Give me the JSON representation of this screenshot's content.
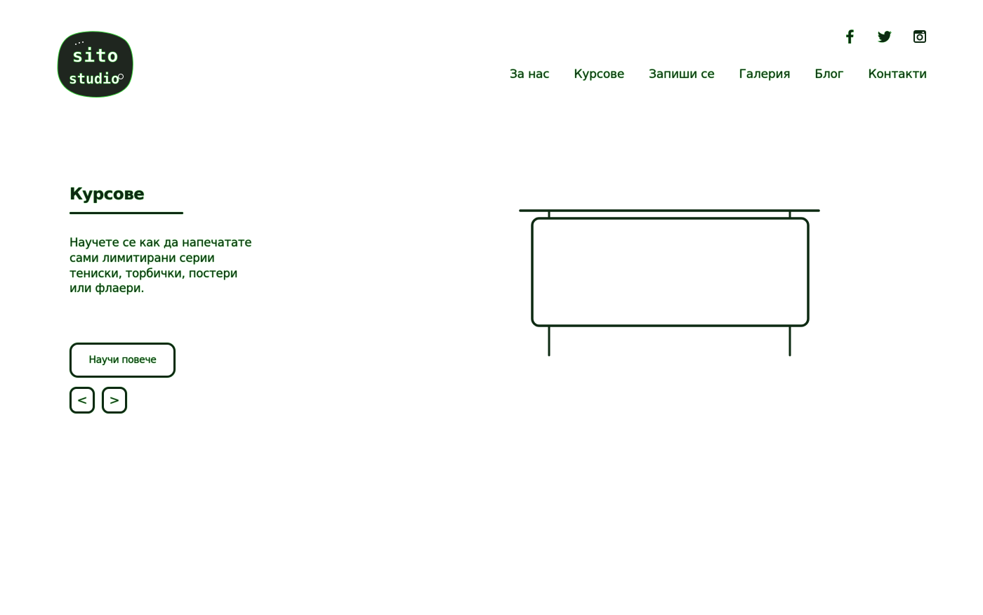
{
  "logo": {
    "line1": "sito",
    "line2": "studio"
  },
  "social": [
    {
      "name": "facebook-icon",
      "label": "f"
    },
    {
      "name": "twitter-icon",
      "label": "twitter"
    },
    {
      "name": "instagram-icon",
      "label": "instagram"
    }
  ],
  "nav": {
    "about": "За нас",
    "courses": "Курсове",
    "signup": "Запиши се",
    "gallery": "Галерия",
    "blog": "Блог",
    "contacts": "Контакти"
  },
  "hero": {
    "title": "Курсове",
    "description": "Научете се как да напечатате сами лимитирани серии тениски, торбички, постери или флаери.",
    "button_label": "Научи повече",
    "prev_label": "<",
    "next_label": ">"
  },
  "colors": {
    "ink": "#0d2a12",
    "glow": "#3bd13b",
    "background": "#ffffff"
  }
}
